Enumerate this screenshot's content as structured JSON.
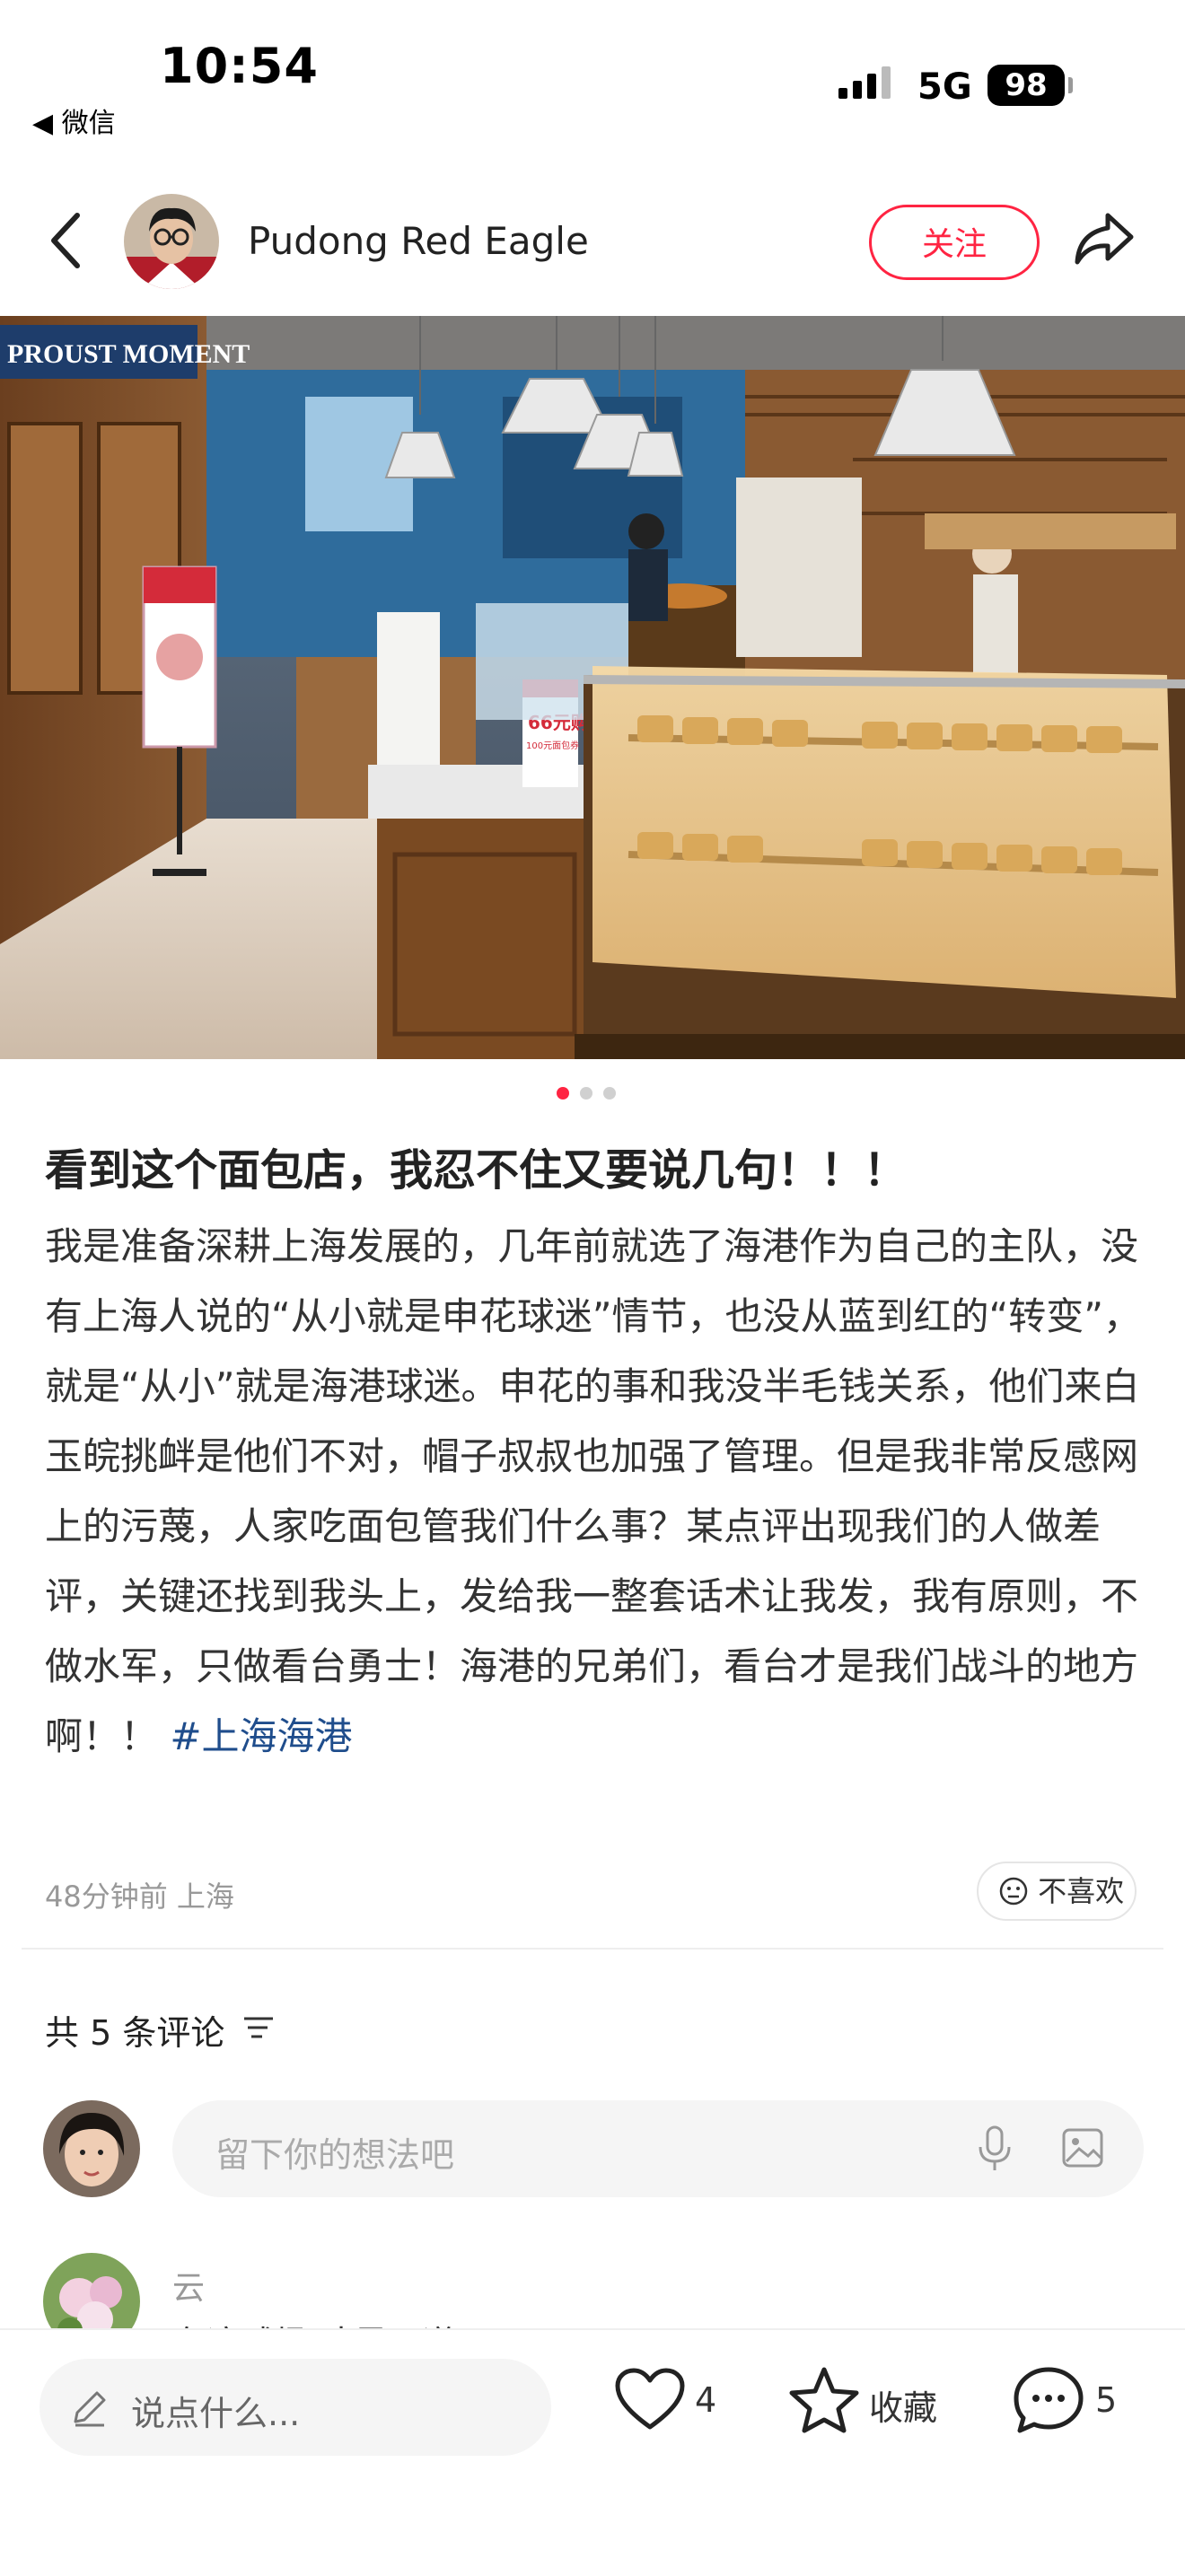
{
  "status": {
    "time": "10:54",
    "back_app": "◀ 微信",
    "network": "5G",
    "battery": "98"
  },
  "header": {
    "author": "Pudong Red Eagle",
    "follow_label": "关注"
  },
  "photo": {
    "shop_sign": "PROUST MOMENT",
    "promo_price": "66元购",
    "promo_sub": "100元面包券"
  },
  "carousel": {
    "count": 3,
    "active": 1
  },
  "post": {
    "title": "看到这个面包店，我忍不住又要说几句！！！",
    "body": "我是准备深耕上海发展的，几年前就选了海港作为自己的主队，没有上海人说的“从小就是申花球迷”情节，也没从蓝到红的“转变”，就是“从小”就是海港球迷。申花的事和我没半毛钱关系，他们来白玉皖挑衅是他们不对，帽子叔叔也加强了管理。但是我非常反感网上的污蔑，人家吃面包管我们什么事？某点评出现我们的人做差评，关键还找到我头上，发给我一整套话术让我发，我有原则，不做水军，只做看台勇士！海港的兄弟们，看台才是我们战斗的地方啊！！ ",
    "hashtag": "#上海海港",
    "meta": "48分钟前 上海",
    "dislike_label": "不喜欢"
  },
  "comments": {
    "count_label": "共 5 条评论",
    "input_placeholder": "留下你的想法吧",
    "first": {
      "name": "云",
      "text": "在这球场 才是王道"
    }
  },
  "bottom": {
    "say_placeholder": "说点什么...",
    "likes": "4",
    "collect_label": "收藏",
    "comments": "5"
  },
  "colors": {
    "brand": "#ff2442",
    "hashtag": "#1f4d8c"
  }
}
